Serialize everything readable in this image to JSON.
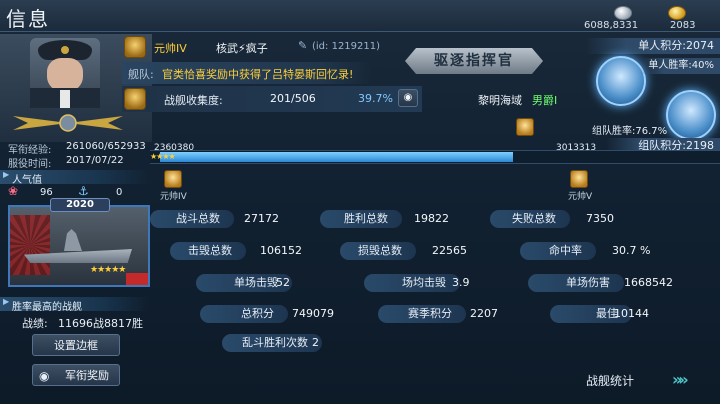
{
  "header": {
    "title": "信息",
    "silver": "6088,8331",
    "gold": "2083"
  },
  "player": {
    "rank": "元帅IV",
    "name": "核武⚡疯子",
    "id": "(id: 1219211)",
    "fleet_label": "舰队:",
    "fleet_announcement": "官类恰喜奖励中获得了吕特晏斯回忆录!",
    "collection_label": "战舰收集度:",
    "collection_count": "201/506",
    "collection_pct": "39.7%",
    "sea_area": "黎明海域",
    "rank_title": "男爵I",
    "commander_title": "驱逐指挥官"
  },
  "left": {
    "exp_label": "军衔经验:",
    "exp_value": "261060/652933",
    "service_label": "服役时间:",
    "service_value": "2017/07/22",
    "popularity_label": "人气值",
    "likes": "96",
    "dislikes": "0",
    "ship_year": "2020",
    "best_ship_label": "胜率最高的战舰",
    "record_label": "战绩:",
    "record_value": "11696战8817胜",
    "set_frame_btn": "设置边框",
    "rank_reward_btn": "军衔奖励"
  },
  "scores": {
    "solo_score": "单人积分:2074",
    "solo_winrate": "单人胜率:40%",
    "team_winrate": "组队胜率:76.7%",
    "team_score": "组队积分:2198"
  },
  "progress": {
    "left_value": "2360380",
    "right_value": "3013313",
    "left_rank": "元帅IV",
    "right_rank": "元帅V",
    "fill_fraction": 0.63
  },
  "stats": [
    {
      "label": "战斗总数",
      "value": "27172"
    },
    {
      "label": "胜利总数",
      "value": "19822"
    },
    {
      "label": "失败总数",
      "value": "7350"
    },
    {
      "label": "击毁总数",
      "value": "106152"
    },
    {
      "label": "损毁总数",
      "value": "22565"
    },
    {
      "label": "命中率",
      "value": "30.7 %"
    },
    {
      "label": "单场击毁",
      "value": "52"
    },
    {
      "label": "场均击毁",
      "value": "3.9"
    },
    {
      "label": "单场伤害",
      "value": "1668542"
    },
    {
      "label": "总积分",
      "value": "749079"
    },
    {
      "label": "赛季积分",
      "value": "2207"
    },
    {
      "label": "最佳",
      "value": "10144"
    },
    {
      "label": "乱斗胜利次数",
      "value": "2"
    }
  ],
  "footer": {
    "fleet_stats": "战舰统计"
  },
  "colors": {
    "accent": "#3fa2f0",
    "gold": "#ffd23a",
    "red": "#ff5a6a",
    "green": "#6cff6c"
  }
}
